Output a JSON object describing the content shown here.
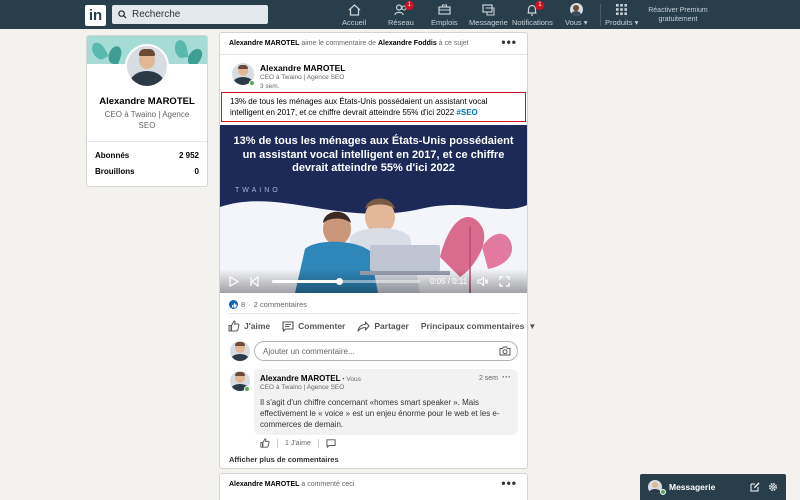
{
  "nav": {
    "logo": "in",
    "search_placeholder": "Recherche",
    "items": [
      {
        "label": "Accueil",
        "icon": "home-icon",
        "badge": ""
      },
      {
        "label": "Réseau",
        "icon": "network-icon",
        "badge": "1"
      },
      {
        "label": "Emplois",
        "icon": "briefcase-icon",
        "badge": ""
      },
      {
        "label": "Messagerie",
        "icon": "messaging-icon",
        "badge": ""
      },
      {
        "label": "Notifications",
        "icon": "bell-icon",
        "badge": "1"
      },
      {
        "label": "Vous",
        "icon": "avatar",
        "badge": ""
      },
      {
        "label": "Produits",
        "icon": "grid-icon",
        "badge": ""
      }
    ],
    "premium_line1": "Réactiver Premium",
    "premium_line2": "gratuitement"
  },
  "profile": {
    "name": "Alexandre MAROTEL",
    "headline": "CEO à Twaino | Agence SEO",
    "stats": [
      {
        "label": "Abonnés",
        "value": "2 952"
      },
      {
        "label": "Brouillons",
        "value": "0"
      }
    ]
  },
  "post": {
    "context_actor": "Alexandre MAROTEL",
    "context_middle": " aime le commentaire de ",
    "context_target": "Alexandre Foddis",
    "context_end": " à ce sujet",
    "author_name": "Alexandre MAROTEL",
    "author_headline": "CEO à Twaino | Agence SEO",
    "time": "3 sem.",
    "text": "13% de tous les ménages aux États-Unis possédaient un assistant vocal intelligent en 2017, et ce chiffre devrait atteindre 55% d'ici 2022 ",
    "hashtag": "#SEO",
    "video": {
      "title_line1": "13% de tous les ménages aux États-Unis possédaient",
      "title_line2": "un assistant vocal intelligent en 2017, et ce chiffre",
      "title_line3": "devrait atteindre 55% d'ici 2022",
      "brand": "TWAINO",
      "time": "0:05 / 0:11",
      "progress": 0.45
    },
    "likes": "8",
    "comments_count": "2 commentaires",
    "actions": {
      "like": "J'aime",
      "comment": "Commenter",
      "share": "Partager",
      "sort": "Principaux commentaires"
    },
    "comment_placeholder": "Ajouter un commentaire...",
    "comment": {
      "name": "Alexandre MAROTEL",
      "you": " • Vous",
      "headline": "CEO à Twaino | Agence SEO",
      "time": "2 sem",
      "text": "Il s'agit d'un chiffre concernant «homes smart speaker ». Mais effectivement le « voice » est un enjeu énorme pour le web et les e-commerces de demain.",
      "likes": "1 J'aime"
    },
    "more_comments": "Afficher plus de commentaires"
  },
  "post2": {
    "context_actor": "Alexandre MAROTEL",
    "context_end": " a commenté ceci"
  },
  "messaging": {
    "label": "Messagerie"
  },
  "colors": {
    "nav_bg": "#283e4a",
    "accent_blue": "#0073b1",
    "highlight_border": "#d11124",
    "video_bg": "#1d2a58"
  }
}
